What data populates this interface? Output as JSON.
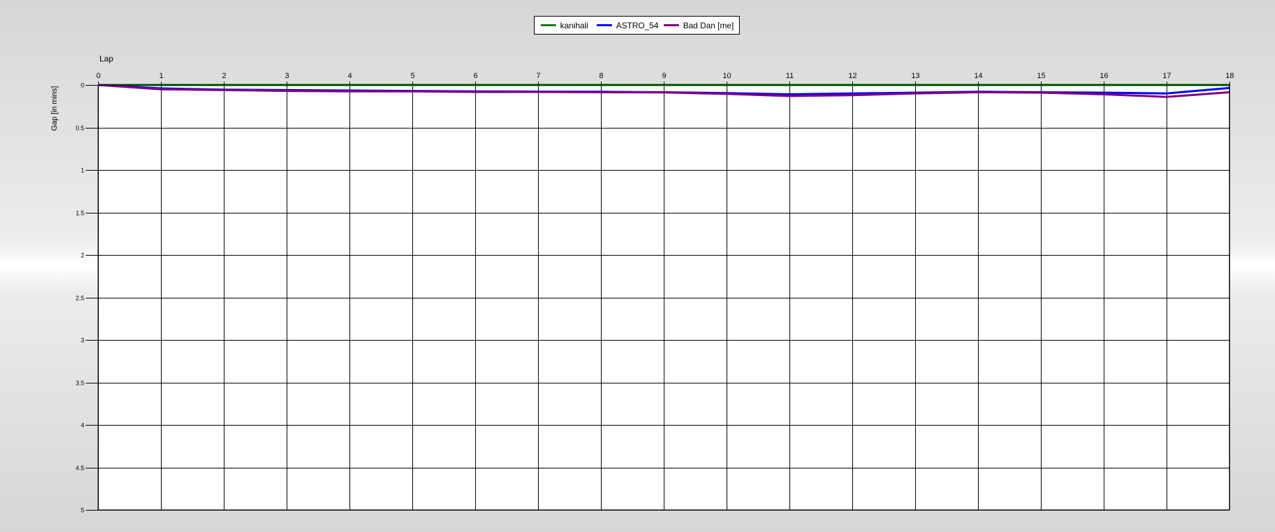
{
  "colors": {
    "background_center": "#ffffff",
    "background_edge": "#d6d6d6",
    "plot_background": "#ffffff",
    "grid": "#000000"
  },
  "chart_data": {
    "type": "line",
    "title": "",
    "xlabel": "Lap",
    "ylabel": "Gap [in mins]",
    "x": [
      0,
      1,
      2,
      3,
      4,
      5,
      6,
      7,
      8,
      9,
      10,
      11,
      12,
      13,
      14,
      15,
      16,
      17,
      18
    ],
    "xlim": [
      0,
      18
    ],
    "ylim": [
      0,
      5
    ],
    "y_inverted": true,
    "x_axis_position": "top",
    "y_ticks": [
      "0",
      "0.5",
      "1",
      "1.5",
      "2",
      "2.5",
      "3",
      "3.5",
      "4",
      "4.5",
      "5"
    ],
    "y_tick_values": [
      0,
      0.5,
      1,
      1.5,
      2,
      2.5,
      3,
      3.5,
      4,
      4.5,
      5
    ],
    "grid": true,
    "legend_position": "top-center",
    "series": [
      {
        "name": "kanihali",
        "color": "#008000",
        "values": [
          0,
          0,
          0,
          0,
          0,
          0,
          0,
          0,
          0,
          0,
          0,
          0,
          0,
          0,
          0,
          0,
          0,
          0,
          0
        ]
      },
      {
        "name": "ASTRO_54",
        "color": "#0000ff",
        "values": [
          0,
          0.04,
          0.055,
          0.06,
          0.065,
          0.07,
          0.075,
          0.078,
          0.08,
          0.085,
          0.095,
          0.11,
          0.1,
          0.09,
          0.08,
          0.085,
          0.09,
          0.1,
          0.035
        ]
      },
      {
        "name": "Bad Dan [me]",
        "color": "#800080",
        "values": [
          0,
          0.05,
          0.06,
          0.07,
          0.075,
          0.075,
          0.082,
          0.082,
          0.085,
          0.088,
          0.105,
          0.13,
          0.12,
          0.1,
          0.085,
          0.09,
          0.11,
          0.14,
          0.085
        ]
      }
    ]
  }
}
